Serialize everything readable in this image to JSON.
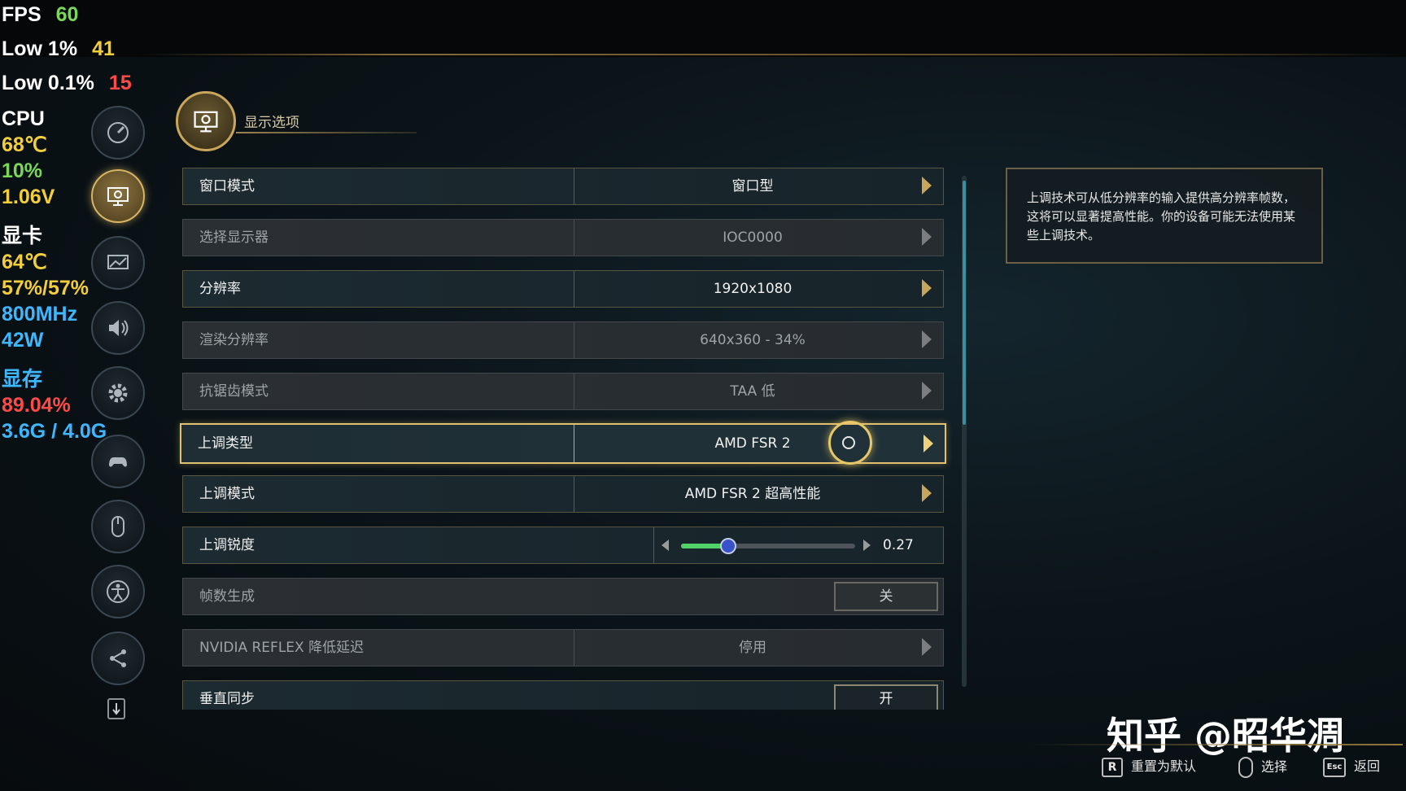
{
  "osd": {
    "fps_label": "FPS",
    "fps": "60",
    "low1_label": "Low 1%",
    "low1": "41",
    "low01_label": "Low 0.1%",
    "low01": "15",
    "cpu_label": "CPU",
    "cpu_temp": "68℃",
    "cpu_load": "10%",
    "cpu_volt": "1.06V",
    "gpu_label": "显卡",
    "gpu_temp": "64℃",
    "gpu_load": "57%/57%",
    "gpu_clock": "800MHz",
    "gpu_power": "42W",
    "vram_label": "显存",
    "vram_pct": "89.04%",
    "vram_used": "3.6G / 4.0G"
  },
  "header": {
    "title": "显示选项"
  },
  "settings": [
    {
      "label": "窗口模式",
      "value": "窗口型"
    },
    {
      "label": "选择显示器",
      "value": "IOC0000"
    },
    {
      "label": "分辨率",
      "value": "1920x1080"
    },
    {
      "label": "渲染分辨率",
      "value": "640x360 - 34%"
    },
    {
      "label": "抗锯齿模式",
      "value": "TAA 低"
    },
    {
      "label": "上调类型",
      "value": "AMD FSR 2"
    },
    {
      "label": "上调模式",
      "value": "AMD FSR 2 超高性能"
    },
    {
      "label": "上调锐度",
      "value": "0.27",
      "slider_level": 0.27
    },
    {
      "label": "帧数生成",
      "value": "关"
    },
    {
      "label": "NVIDIA REFLEX 降低延迟",
      "value": "停用"
    },
    {
      "label": "垂直同步",
      "value": "开"
    }
  ],
  "tooltip": {
    "text": "上调技术可从低分辨率的输入提供高分辨率帧数，这将可以显著提高性能。你的设备可能无法使用某些上调技术。"
  },
  "watermark": "知乎 @昭华凋",
  "footer": {
    "reset_key": "R",
    "reset_label": "重置为默认",
    "select_label": "选择",
    "back_key": "Esc",
    "back_label": "返回"
  },
  "sidebar_icons": [
    "performance-gauge-icon",
    "display-icon",
    "graphics-icon",
    "audio-icon",
    "gameplay-gear-icon",
    "controller-icon",
    "mouse-icon",
    "accessibility-icon",
    "network-icon",
    "scroll-down-icon"
  ]
}
